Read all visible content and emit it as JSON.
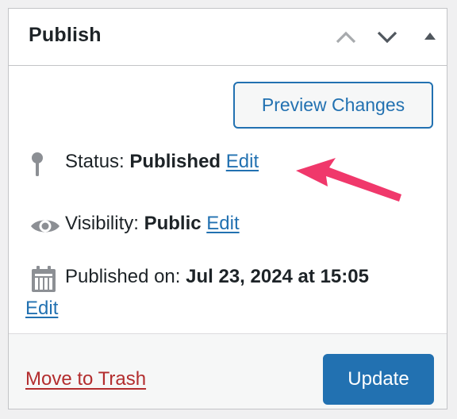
{
  "header": {
    "title": "Publish",
    "controls": [
      "move-up",
      "move-down",
      "toggle-panel"
    ]
  },
  "actions": {
    "preview_label": "Preview Changes",
    "trash_label": "Move to Trash",
    "update_label": "Update"
  },
  "status": {
    "label": "Status:",
    "value": "Published",
    "edit_label": "Edit",
    "icon": "pin-icon"
  },
  "visibility": {
    "label": "Visibility:",
    "value": "Public",
    "edit_label": "Edit",
    "icon": "eye-icon"
  },
  "published_on": {
    "label": "Published on:",
    "value": "Jul 23, 2024 at 15:05",
    "edit_label": "Edit",
    "icon": "calendar-icon"
  },
  "annotation": {
    "icon": "arrow-pointer-icon",
    "color": "#f0386b"
  },
  "colors": {
    "accent": "#2271b1",
    "danger": "#b32d2e",
    "text": "#1d2327",
    "icon_gray": "#8c8f94"
  }
}
